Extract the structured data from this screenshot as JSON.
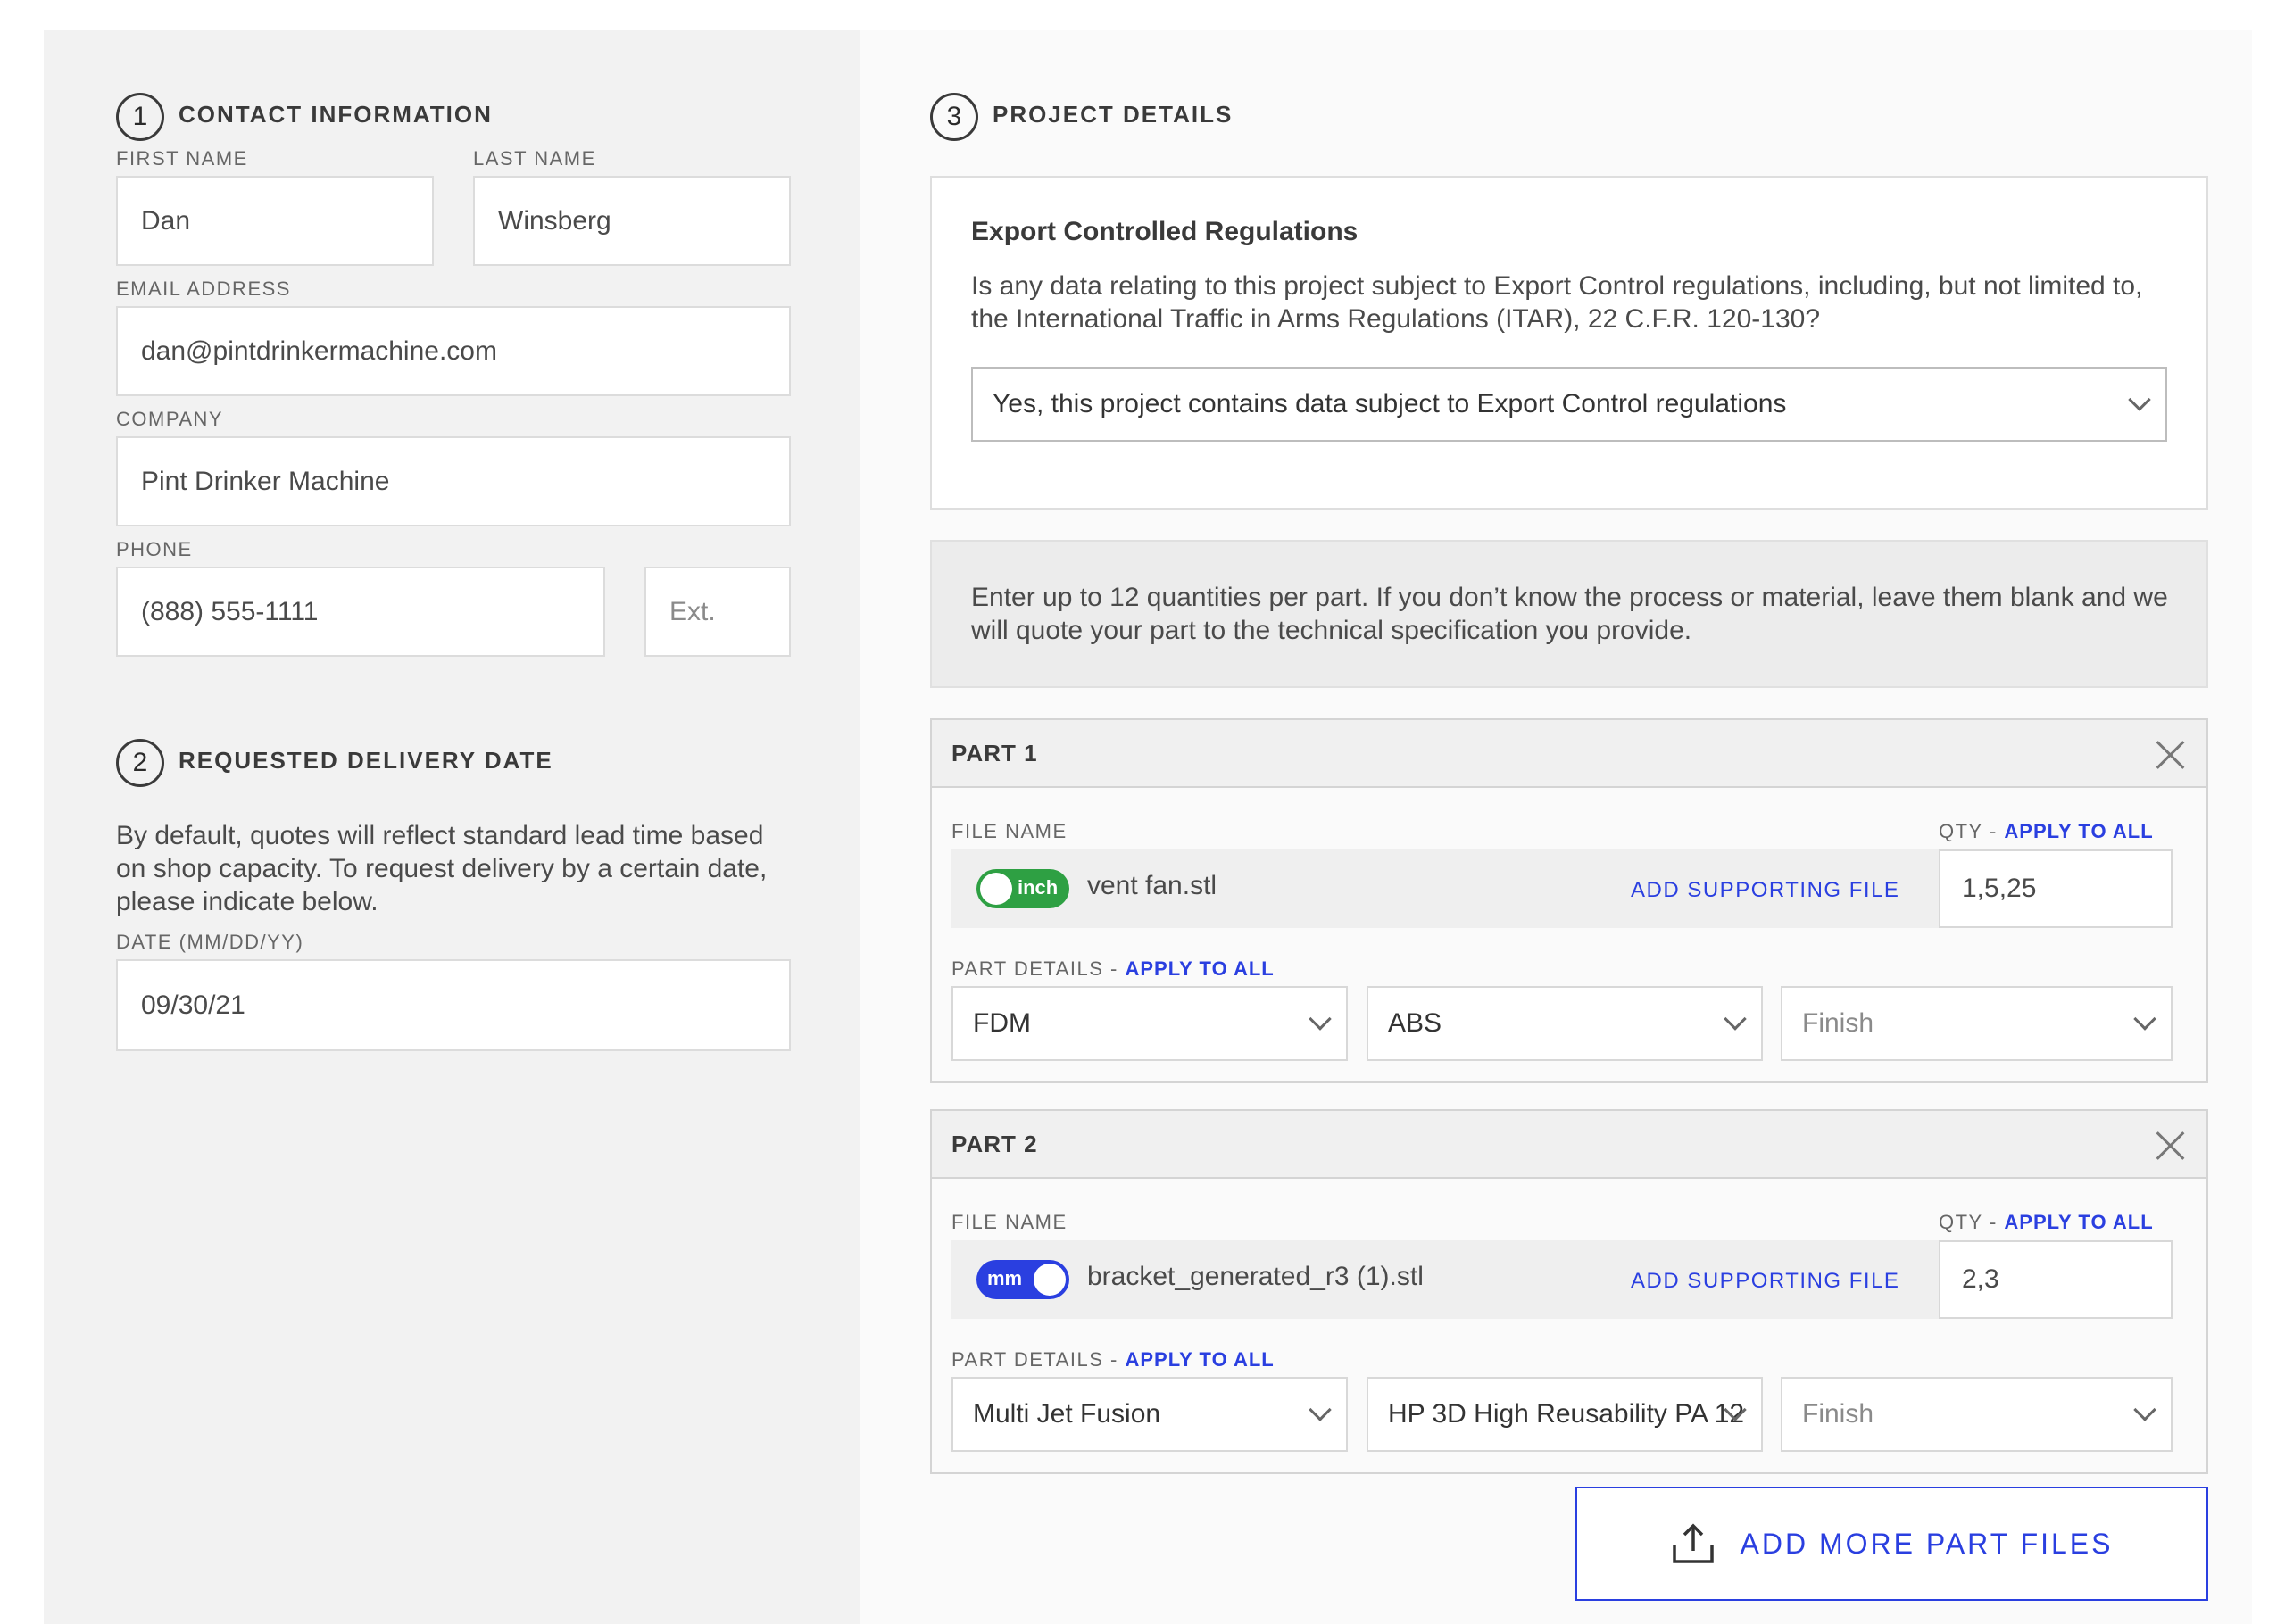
{
  "contact": {
    "step": "1",
    "title": "CONTACT INFORMATION",
    "first_name_label": "FIRST NAME",
    "first_name": "Dan",
    "last_name_label": "LAST NAME",
    "last_name": "Winsberg",
    "email_label": "EMAIL ADDRESS",
    "email": "dan@pintdrinkermachine.com",
    "company_label": "COMPANY",
    "company": "Pint Drinker Machine",
    "phone_label": "PHONE",
    "phone": "(888) 555-1111",
    "ext_placeholder": "Ext."
  },
  "delivery": {
    "step": "2",
    "title": "REQUESTED DELIVERY DATE",
    "description": "By default, quotes will reflect standard lead time based on shop capacity. To request delivery by a certain date, please indicate below.",
    "date_label": "DATE (MM/DD/YY)",
    "date": "09/30/21"
  },
  "project": {
    "step": "3",
    "title": "PROJECT DETAILS",
    "export": {
      "title": "Export Controlled Regulations",
      "question": "Is any data relating to this project subject to Export Control regulations, including, but not limited to, the International Traffic in Arms Regulations (ITAR), 22 C.F.R. 120-130?",
      "selected": "Yes, this project contains data subject to Export Control regulations"
    },
    "info": "Enter up to 12 quantities per part. If you don’t know the process or material, leave them blank and we will quote your part to the technical specification you provide.",
    "file_name_label": "FILE NAME",
    "qty_label": "QTY",
    "part_details_label": "PART DETAILS",
    "apply_to_all": "APPLY TO ALL",
    "separator": " - ",
    "add_supporting": "ADD SUPPORTING FILE",
    "parts": [
      {
        "title": "PART 1",
        "unit": "inch",
        "unit_color": "#2ea043",
        "file_name": "vent fan.stl",
        "qty": "1,5,25",
        "process": "FDM",
        "material": "ABS",
        "finish": "Finish"
      },
      {
        "title": "PART 2",
        "unit": "mm",
        "unit_color": "#2a3fe0",
        "file_name": "bracket_generated_r3 (1).stl",
        "qty": "2,3",
        "process": "Multi Jet Fusion",
        "material": "HP 3D High Reusability PA 12",
        "finish": "Finish"
      }
    ],
    "add_more": "ADD MORE PART FILES"
  },
  "colors": {
    "accent": "#2a3fe0",
    "toggle_inch": "#2ea043",
    "toggle_mm": "#2a3fe0",
    "left_bg": "#f2f2f2"
  },
  "icons": [
    "upload-icon",
    "close-icon",
    "chevron-down-icon"
  ]
}
